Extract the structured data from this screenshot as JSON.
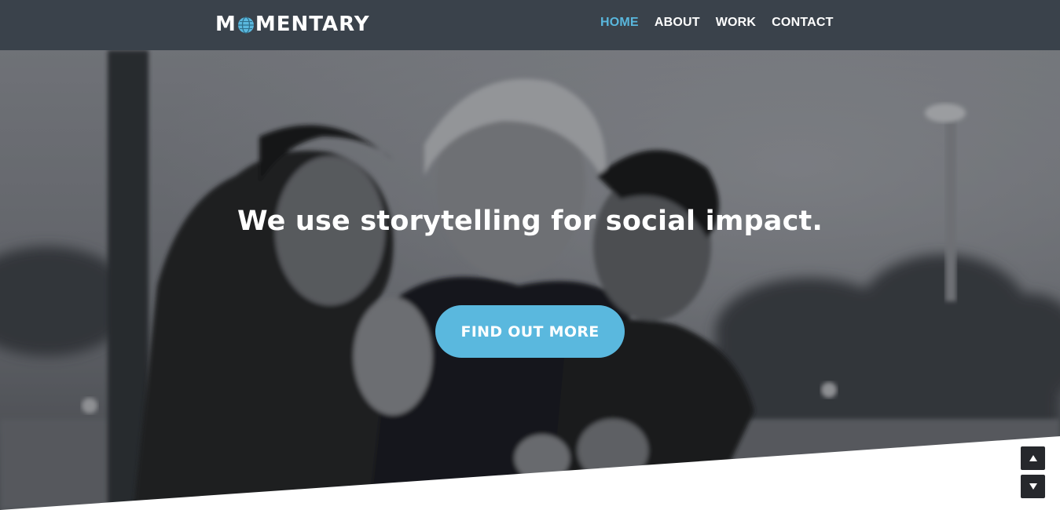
{
  "header": {
    "logo_text_left": "M",
    "logo_text_right": "MENTARY",
    "nav": [
      {
        "label": "HOME",
        "active": true
      },
      {
        "label": "ABOUT",
        "active": false
      },
      {
        "label": "WORK",
        "active": false
      },
      {
        "label": "CONTACT",
        "active": false
      }
    ]
  },
  "hero": {
    "headline": "We use storytelling for social impact.",
    "cta_label": "FIND OUT MORE"
  },
  "scroll_controls": {
    "up_icon": "arrow-up-icon",
    "down_icon": "arrow-down-icon"
  },
  "colors": {
    "header_bg": "#3a424b",
    "accent": "#5ab8de",
    "active_nav": "#59b7dd",
    "scroll_button_bg": "#26282c"
  }
}
